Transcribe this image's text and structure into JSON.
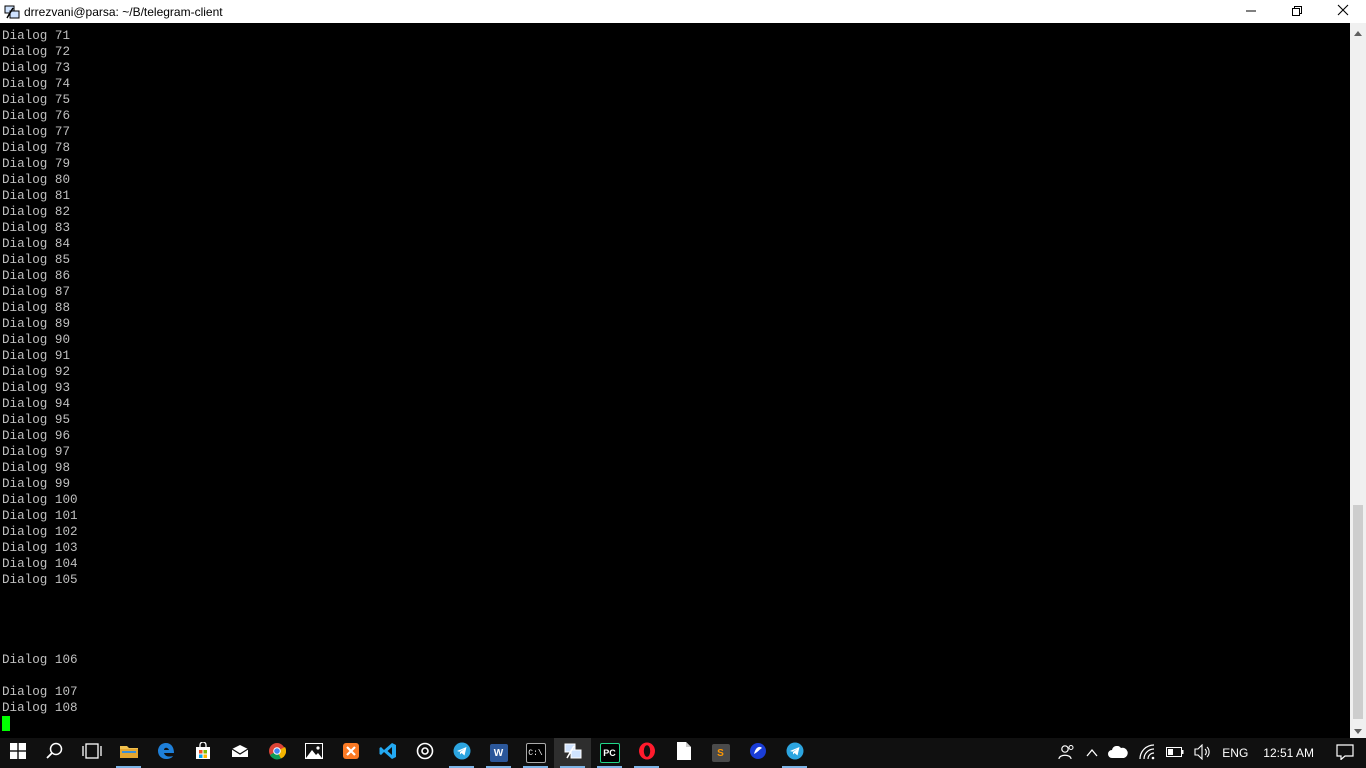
{
  "window": {
    "title": "drrezvani@parsa: ~/B/telegram-client",
    "app_icon": "putty-icon",
    "controls": [
      "minimize-icon",
      "restore-icon",
      "close-icon"
    ]
  },
  "terminal": {
    "lines": [
      "Dialog 71",
      "Dialog 72",
      "Dialog 73",
      "Dialog 74",
      "Dialog 75",
      "Dialog 76",
      "Dialog 77",
      "Dialog 78",
      "Dialog 79",
      "Dialog 80",
      "Dialog 81",
      "Dialog 82",
      "Dialog 83",
      "Dialog 84",
      "Dialog 85",
      "Dialog 86",
      "Dialog 87",
      "Dialog 88",
      "Dialog 89",
      "Dialog 90",
      "Dialog 91",
      "Dialog 92",
      "Dialog 93",
      "Dialog 94",
      "Dialog 95",
      "Dialog 96",
      "Dialog 97",
      "Dialog 98",
      "Dialog 99",
      "Dialog 100",
      "Dialog 101",
      "Dialog 102",
      "Dialog 103",
      "Dialog 104",
      "Dialog 105",
      "",
      "",
      "",
      "",
      "Dialog 106",
      "",
      "Dialog 107",
      "Dialog 108",
      ""
    ],
    "text_color": "#c0c0c0",
    "background": "#000000",
    "cursor_color": "#00ff00"
  },
  "taskbar": {
    "pinned": [
      {
        "name": "start-button",
        "icon": "windows-logo-icon"
      },
      {
        "name": "search-button",
        "icon": "search-icon"
      },
      {
        "name": "task-view-button",
        "icon": "task-view-icon"
      },
      {
        "name": "taskbar-file-explorer",
        "icon": "folder-icon"
      },
      {
        "name": "taskbar-edge",
        "icon": "edge-icon"
      },
      {
        "name": "taskbar-store",
        "icon": "store-icon"
      },
      {
        "name": "taskbar-mail",
        "icon": "mail-icon"
      },
      {
        "name": "taskbar-chrome",
        "icon": "chrome-icon"
      },
      {
        "name": "taskbar-photos",
        "icon": "photos-icon"
      },
      {
        "name": "taskbar-xampp",
        "icon": "xampp-icon"
      },
      {
        "name": "taskbar-vscode",
        "icon": "vscode-icon"
      },
      {
        "name": "taskbar-groove",
        "icon": "groove-icon"
      },
      {
        "name": "taskbar-telegram",
        "icon": "telegram-icon"
      },
      {
        "name": "taskbar-word",
        "icon": "word-icon",
        "label": "W"
      },
      {
        "name": "taskbar-cmd",
        "icon": "cmd-icon",
        "label": "C:\\"
      },
      {
        "name": "taskbar-putty",
        "icon": "putty-icon"
      },
      {
        "name": "taskbar-pycharm",
        "icon": "pycharm-icon",
        "label": "PC"
      },
      {
        "name": "taskbar-opera",
        "icon": "opera-icon"
      },
      {
        "name": "taskbar-notepad",
        "icon": "file-icon"
      },
      {
        "name": "taskbar-sublime",
        "icon": "sublime-icon",
        "label": "S"
      },
      {
        "name": "taskbar-app-blue",
        "icon": "blue-app-icon"
      },
      {
        "name": "taskbar-telegram-2",
        "icon": "telegram-icon"
      }
    ],
    "tray": {
      "language": "ENG",
      "time": "12:51 AM"
    }
  }
}
